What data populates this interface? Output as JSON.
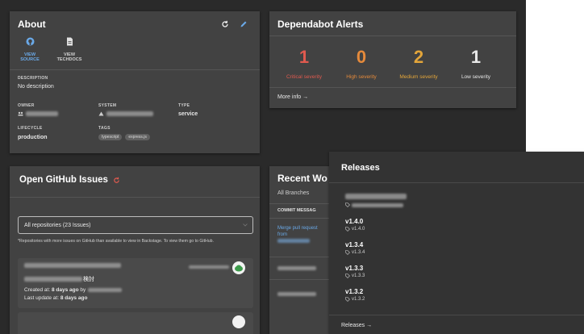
{
  "about": {
    "title": "About",
    "view_source_line1": "VIEW",
    "view_source_line2": "SOURCE",
    "view_techdocs_line1": "VIEW",
    "view_techdocs_line2": "TECHDOCS",
    "description_label": "DESCRIPTION",
    "description_value": "No description",
    "owner_label": "OWNER",
    "system_label": "SYSTEM",
    "type_label": "TYPE",
    "type_value": "service",
    "lifecycle_label": "LIFECYCLE",
    "lifecycle_value": "production",
    "tags_label": "TAGS",
    "tags": [
      "typescript",
      "express.js"
    ]
  },
  "dependabot": {
    "title": "Dependabot Alerts",
    "critical_count": "1",
    "critical_label": "Critical severity",
    "high_count": "0",
    "high_label": "High severity",
    "medium_count": "2",
    "medium_label": "Medium severity",
    "low_count": "1",
    "low_label": "Low severity",
    "more_info": "More info →",
    "colors": {
      "critical": "#e05a4f",
      "high": "#e58a3b",
      "medium": "#e3a53a",
      "low": "#e8e8e8"
    }
  },
  "issues": {
    "title": "Open GitHub Issues",
    "select_value": "All repositories (23 Issues)",
    "note": "*Repositories with more issues on GitHub than available to view in Backstage. To view them go to GitHub.",
    "issue_title_suffix": "検討",
    "created_prefix": "Created at: ",
    "created_value": "8 days ago",
    "created_by": " by",
    "updated_prefix": "Last update at: ",
    "updated_value": "8 days ago"
  },
  "recent": {
    "title": "Recent Wo",
    "branches": "All Branches",
    "commit_header": "COMMIT MESSAG",
    "commit_link_line1": "Merge pull request",
    "commit_link_line2": "from"
  },
  "releases": {
    "title": "Releases",
    "items": [
      {
        "version": "v1.4.0",
        "tag": "v1.4.0"
      },
      {
        "version": "v1.3.4",
        "tag": "v1.3.4"
      },
      {
        "version": "v1.3.3",
        "tag": "v1.3.3"
      },
      {
        "version": "v1.3.2",
        "tag": "v1.3.2"
      }
    ],
    "footer_link": "Releases →"
  }
}
